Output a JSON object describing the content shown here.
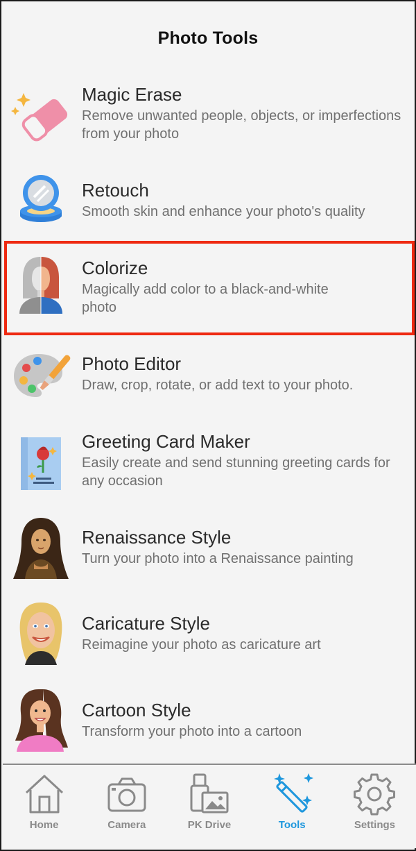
{
  "header": {
    "title": "Photo Tools"
  },
  "tools": [
    {
      "title": "Magic Erase",
      "desc": "Remove unwanted people, objects, or imperfections from your photo",
      "icon": "eraser-icon"
    },
    {
      "title": "Retouch",
      "desc": "Smooth skin and enhance your photo's quality",
      "icon": "compact-mirror-icon"
    },
    {
      "title": "Colorize",
      "desc": "Magically add color to a black-and-white photo",
      "icon": "colorize-portrait-icon"
    },
    {
      "title": "Photo Editor",
      "desc": "Draw, crop, rotate, or add text to your photo.",
      "icon": "paint-palette-icon"
    },
    {
      "title": "Greeting Card Maker",
      "desc": "Easily create and send stunning greeting cards for any occasion",
      "icon": "greeting-card-icon"
    },
    {
      "title": "Renaissance Style",
      "desc": "Turn your photo into a Renaissance painting",
      "icon": "renaissance-portrait-icon"
    },
    {
      "title": "Caricature Style",
      "desc": "Reimagine your photo as caricature art",
      "icon": "caricature-portrait-icon"
    },
    {
      "title": "Cartoon Style",
      "desc": "Transform your photo into a cartoon",
      "icon": "cartoon-portrait-icon"
    }
  ],
  "tabs": [
    {
      "label": "Home",
      "icon": "home-icon",
      "active": false
    },
    {
      "label": "Camera",
      "icon": "camera-icon",
      "active": false
    },
    {
      "label": "PK Drive",
      "icon": "drive-icon",
      "active": false
    },
    {
      "label": "Tools",
      "icon": "magic-wand-icon",
      "active": true
    },
    {
      "label": "Settings",
      "icon": "gear-icon",
      "active": false
    }
  ],
  "colors": {
    "accent": "#1e97dd",
    "highlight": "#ee2a12",
    "inactive": "#8a8a8a"
  }
}
